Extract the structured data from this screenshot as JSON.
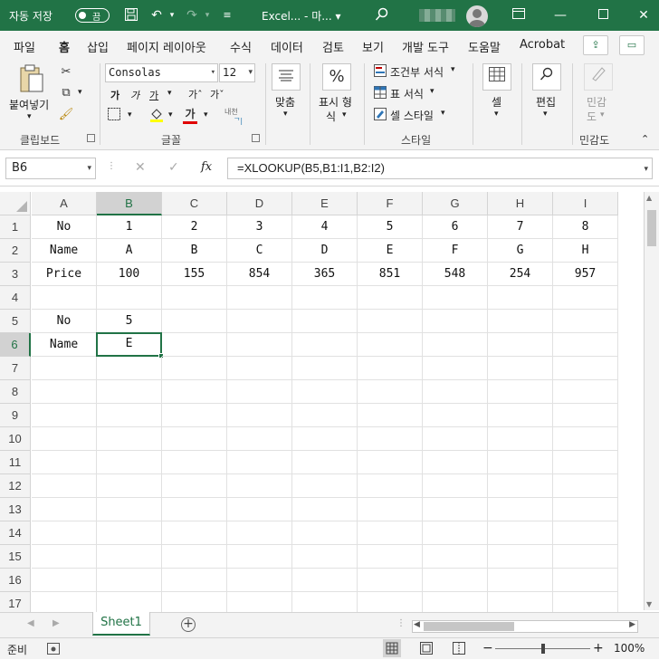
{
  "titlebar": {
    "autosave_label": "자동 저장",
    "autosave_state": "끔",
    "file_title": "Excel...  -  마... ▾",
    "colors": {
      "bg": "#217346"
    }
  },
  "tabs": [
    "파일",
    "홈",
    "삽입",
    "페이지 레이아웃",
    "수식",
    "데이터",
    "검토",
    "보기",
    "개발 도구",
    "도움말",
    "Acrobat"
  ],
  "active_tab": "홈",
  "ribbon": {
    "clipboard": {
      "paste": "붙여넣기",
      "label": "클립보드"
    },
    "font": {
      "name": "Consolas",
      "size": "12",
      "label": "글꼴",
      "grow": "가ˆ",
      "shrink": "가ˇ",
      "bold": "가",
      "italic": "가",
      "underline": "가",
      "color_letter": "가",
      "phonetic": "내천"
    },
    "alignment": {
      "label": "맞춤"
    },
    "number": {
      "label_line1": "표시 형",
      "label_line2": "식"
    },
    "styles": {
      "conditional": "조건부 서식",
      "table": "표 서식",
      "cell": "셀 스타일",
      "label": "스타일"
    },
    "cells": {
      "label": "셀"
    },
    "editing": {
      "label": "편집"
    },
    "sensitivity": {
      "label_line1": "민감",
      "label_line2": "도",
      "group": "민감도"
    }
  },
  "formula_bar": {
    "name_box": "B6",
    "formula": "=XLOOKUP(B5,B1:I1,B2:I2)",
    "fx": "fx"
  },
  "grid": {
    "columns": [
      "A",
      "B",
      "C",
      "D",
      "E",
      "F",
      "G",
      "H",
      "I"
    ],
    "rows": [
      "1",
      "2",
      "3",
      "4",
      "5",
      "6",
      "7",
      "8",
      "9",
      "10",
      "11",
      "12",
      "13",
      "14",
      "15",
      "16",
      "17"
    ],
    "cells": [
      [
        "No",
        "1",
        "2",
        "3",
        "4",
        "5",
        "6",
        "7",
        "8"
      ],
      [
        "Name",
        "A",
        "B",
        "C",
        "D",
        "E",
        "F",
        "G",
        "H"
      ],
      [
        "Price",
        "100",
        "155",
        "854",
        "365",
        "851",
        "548",
        "254",
        "957"
      ],
      [
        "",
        "",
        "",
        "",
        "",
        "",
        "",
        "",
        ""
      ],
      [
        "No",
        "5",
        "",
        "",
        "",
        "",
        "",
        "",
        ""
      ],
      [
        "Name",
        "E",
        "",
        "",
        "",
        "",
        "",
        "",
        ""
      ]
    ],
    "selected_col": "B",
    "selected_row": "6"
  },
  "sheets": {
    "active": "Sheet1"
  },
  "status": {
    "mode": "준비",
    "zoom": "100%"
  }
}
